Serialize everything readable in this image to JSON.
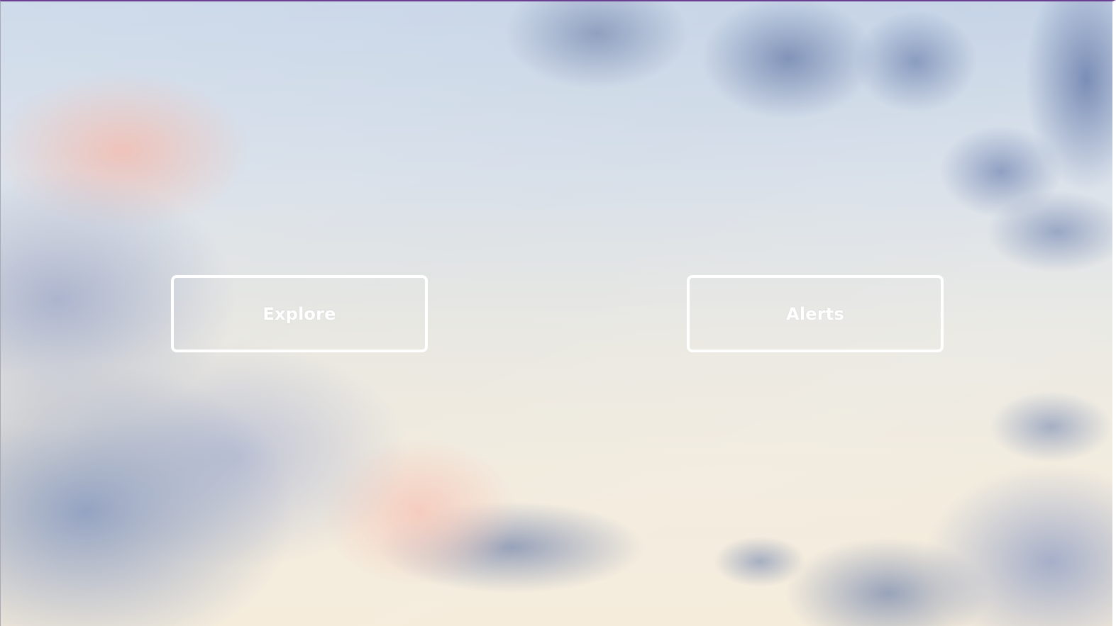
{
  "screen": {
    "background": "cloudy-sky-photo"
  },
  "buttons": [
    {
      "label": "Explore"
    },
    {
      "label": "Alerts"
    }
  ],
  "colors": {
    "top_border": "#6a3f8f",
    "button_border": "#ffffff",
    "button_text": "#ffffff"
  }
}
